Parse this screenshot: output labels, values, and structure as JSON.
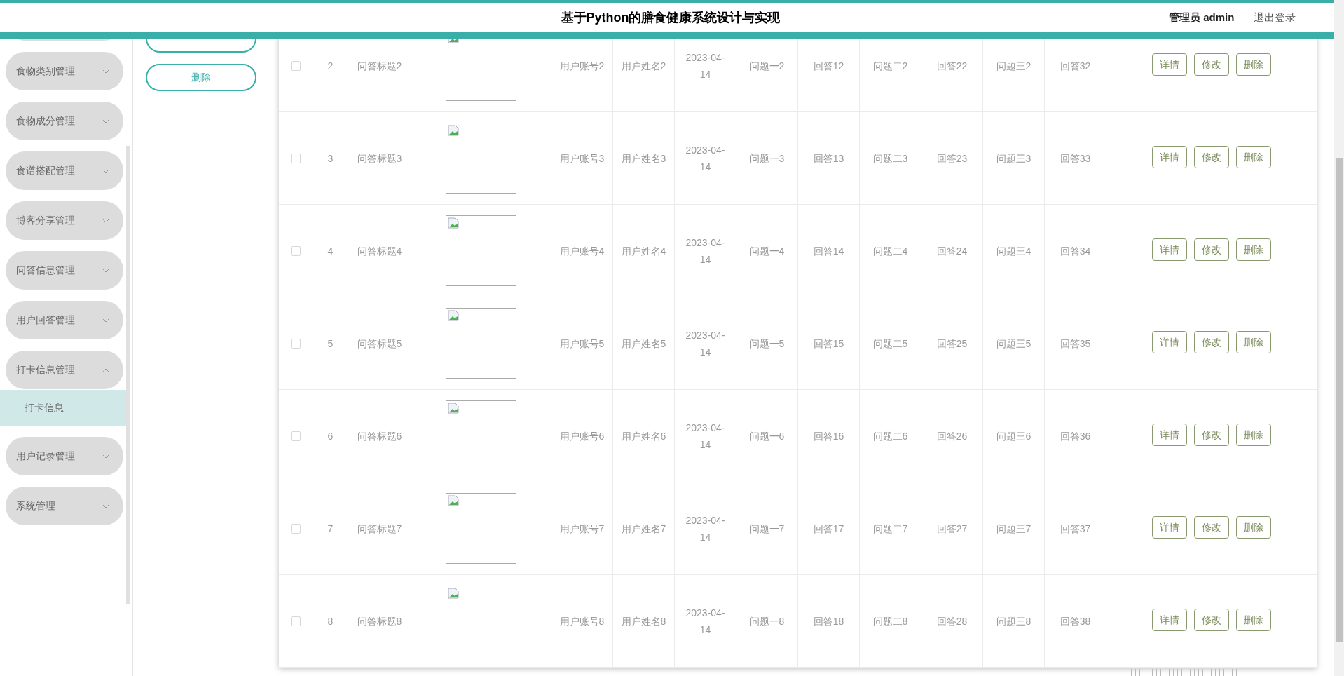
{
  "header": {
    "title": "基于Python的膳食健康系统设计与实现",
    "user": "管理员 admin",
    "logout": "退出登录"
  },
  "sidebar": {
    "items": [
      {
        "label": "食物类别管理",
        "expanded": false
      },
      {
        "label": "食物成分管理",
        "expanded": false
      },
      {
        "label": "食谱搭配管理",
        "expanded": false
      },
      {
        "label": "博客分享管理",
        "expanded": false
      },
      {
        "label": "问答信息管理",
        "expanded": false
      },
      {
        "label": "用户回答管理",
        "expanded": false
      },
      {
        "label": "打卡信息管理",
        "expanded": true,
        "children": [
          {
            "label": "打卡信息",
            "selected": true
          }
        ]
      },
      {
        "label": "用户记录管理",
        "expanded": false
      },
      {
        "label": "系统管理",
        "expanded": false
      }
    ]
  },
  "toolbar": {
    "buttons": [
      "删除"
    ]
  },
  "table": {
    "rows": [
      {
        "checked": false,
        "cells": [
          "2",
          "问答标题2",
          "用户账号2",
          "用户姓名2",
          "2023-04-14",
          "问题一2",
          "回答12",
          "问题二2",
          "回答22",
          "问题三2",
          "回答32"
        ],
        "actions": [
          "详情",
          "修改",
          "删除"
        ]
      },
      {
        "checked": false,
        "cells": [
          "3",
          "问答标题3",
          "用户账号3",
          "用户姓名3",
          "2023-04-14",
          "问题一3",
          "回答13",
          "问题二3",
          "回答23",
          "问题三3",
          "回答33"
        ],
        "actions": [
          "详情",
          "修改",
          "删除"
        ]
      },
      {
        "checked": false,
        "cells": [
          "4",
          "问答标题4",
          "用户账号4",
          "用户姓名4",
          "2023-04-14",
          "问题一4",
          "回答14",
          "问题二4",
          "回答24",
          "问题三4",
          "回答34"
        ],
        "actions": [
          "详情",
          "修改",
          "删除"
        ]
      },
      {
        "checked": false,
        "cells": [
          "5",
          "问答标题5",
          "用户账号5",
          "用户姓名5",
          "2023-04-14",
          "问题一5",
          "回答15",
          "问题二5",
          "回答25",
          "问题三5",
          "回答35"
        ],
        "actions": [
          "详情",
          "修改",
          "删除"
        ]
      },
      {
        "checked": false,
        "cells": [
          "6",
          "问答标题6",
          "用户账号6",
          "用户姓名6",
          "2023-04-14",
          "问题一6",
          "回答16",
          "问题二6",
          "回答26",
          "问题三6",
          "回答36"
        ],
        "actions": [
          "详情",
          "修改",
          "删除"
        ]
      },
      {
        "checked": false,
        "cells": [
          "7",
          "问答标题7",
          "用户账号7",
          "用户姓名7",
          "2023-04-14",
          "问题一7",
          "回答17",
          "问题二7",
          "回答27",
          "问题三7",
          "回答37"
        ],
        "actions": [
          "详情",
          "修改",
          "删除"
        ]
      },
      {
        "checked": false,
        "cells": [
          "8",
          "问答标题8",
          "用户账号8",
          "用户姓名8",
          "2023-04-14",
          "问题一8",
          "回答18",
          "问题二8",
          "回答28",
          "问题三8",
          "回答38"
        ],
        "actions": [
          "详情",
          "修改",
          "删除"
        ]
      }
    ]
  }
}
